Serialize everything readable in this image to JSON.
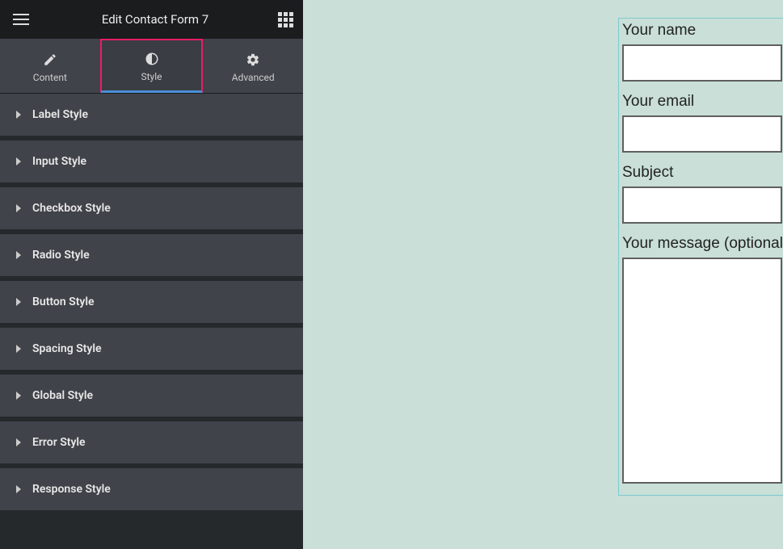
{
  "header": {
    "title": "Edit Contact Form 7"
  },
  "tabs": [
    {
      "id": "content",
      "label": "Content",
      "icon": "pencil"
    },
    {
      "id": "style",
      "label": "Style",
      "icon": "contrast",
      "active": true
    },
    {
      "id": "advanced",
      "label": "Advanced",
      "icon": "gear"
    }
  ],
  "sections": [
    {
      "label": "Label Style"
    },
    {
      "label": "Input Style"
    },
    {
      "label": "Checkbox Style"
    },
    {
      "label": "Radio Style"
    },
    {
      "label": "Button Style"
    },
    {
      "label": "Spacing Style"
    },
    {
      "label": "Global Style"
    },
    {
      "label": "Error Style"
    },
    {
      "label": "Response Style"
    }
  ],
  "form": {
    "fields": [
      {
        "label": "Your name",
        "type": "text"
      },
      {
        "label": "Your email",
        "type": "text"
      },
      {
        "label": "Subject",
        "type": "text"
      },
      {
        "label": "Your message (optional)",
        "type": "textarea"
      }
    ]
  }
}
